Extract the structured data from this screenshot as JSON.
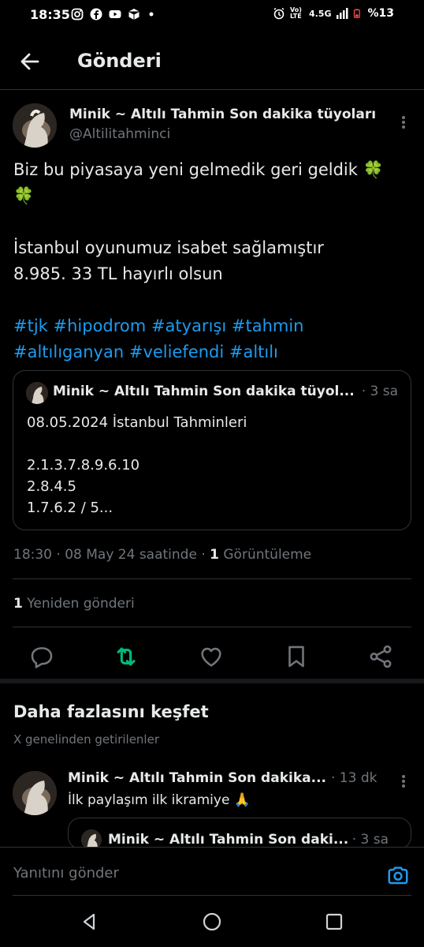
{
  "status_bar": {
    "time": "18:35",
    "network": "4.5G",
    "volte": "Vo) LTE",
    "battery": "%13"
  },
  "header": {
    "title": "Gönderi"
  },
  "post": {
    "author_name": "Minik ~ Altılı Tahmin Son dakika tüyoları",
    "author_handle": "@Altilitahminci",
    "text_line1": "Biz bu piyasaya yeni gelmedik geri geldik",
    "clover": "🍀",
    "text_para2_line1": "İstanbul oyunumuz isabet sağlamıştır",
    "text_para2_line2": "8.985. 33 TL hayırlı olsun",
    "hashtags": [
      "#tjk",
      "#hipodrom",
      "#atyarışı",
      "#tahmin",
      "#altılıganyan",
      "#veliefendi",
      "#altılı"
    ],
    "quote": {
      "author_name": "Minik ~ Altılı Tahmin Son dakika tüyol...",
      "time": "· 3 sa",
      "lines": [
        "08.05.2024 İstanbul Tahminleri",
        "",
        "2.1.3.7.8.9.6.10",
        "2.8.4.5",
        "1.7.6.2 / 5..."
      ]
    },
    "meta_time": "18:30 · 08 May 24 saatinde · ",
    "views_count": "1",
    "views_label": " Görüntüleme",
    "reposts_count": "1",
    "reposts_label": " Yeniden gönderi"
  },
  "actions": [
    "reply-icon",
    "repost-icon",
    "like-icon",
    "bookmark-icon",
    "share-icon"
  ],
  "colors": {
    "accent": "#1d9bf0",
    "repost_active": "#00ba7c",
    "muted": "#71767b",
    "border": "#2f3336"
  },
  "discover": {
    "title": "Daha fazlasını keşfet",
    "subtitle": "X genelinden getirilenler",
    "reply": {
      "author_name": "Minik ~ Altılı Tahmin Son dakika...",
      "time": "· 13 dk",
      "text": "İlk paylaşım ilk ikramiye",
      "emoji": "🙏",
      "quote_author": "Minik ~ Altılı Tahmin Son daki...",
      "quote_time": "· 3 sa"
    }
  },
  "reply_bar": {
    "placeholder": "Yanıtını gönder"
  }
}
